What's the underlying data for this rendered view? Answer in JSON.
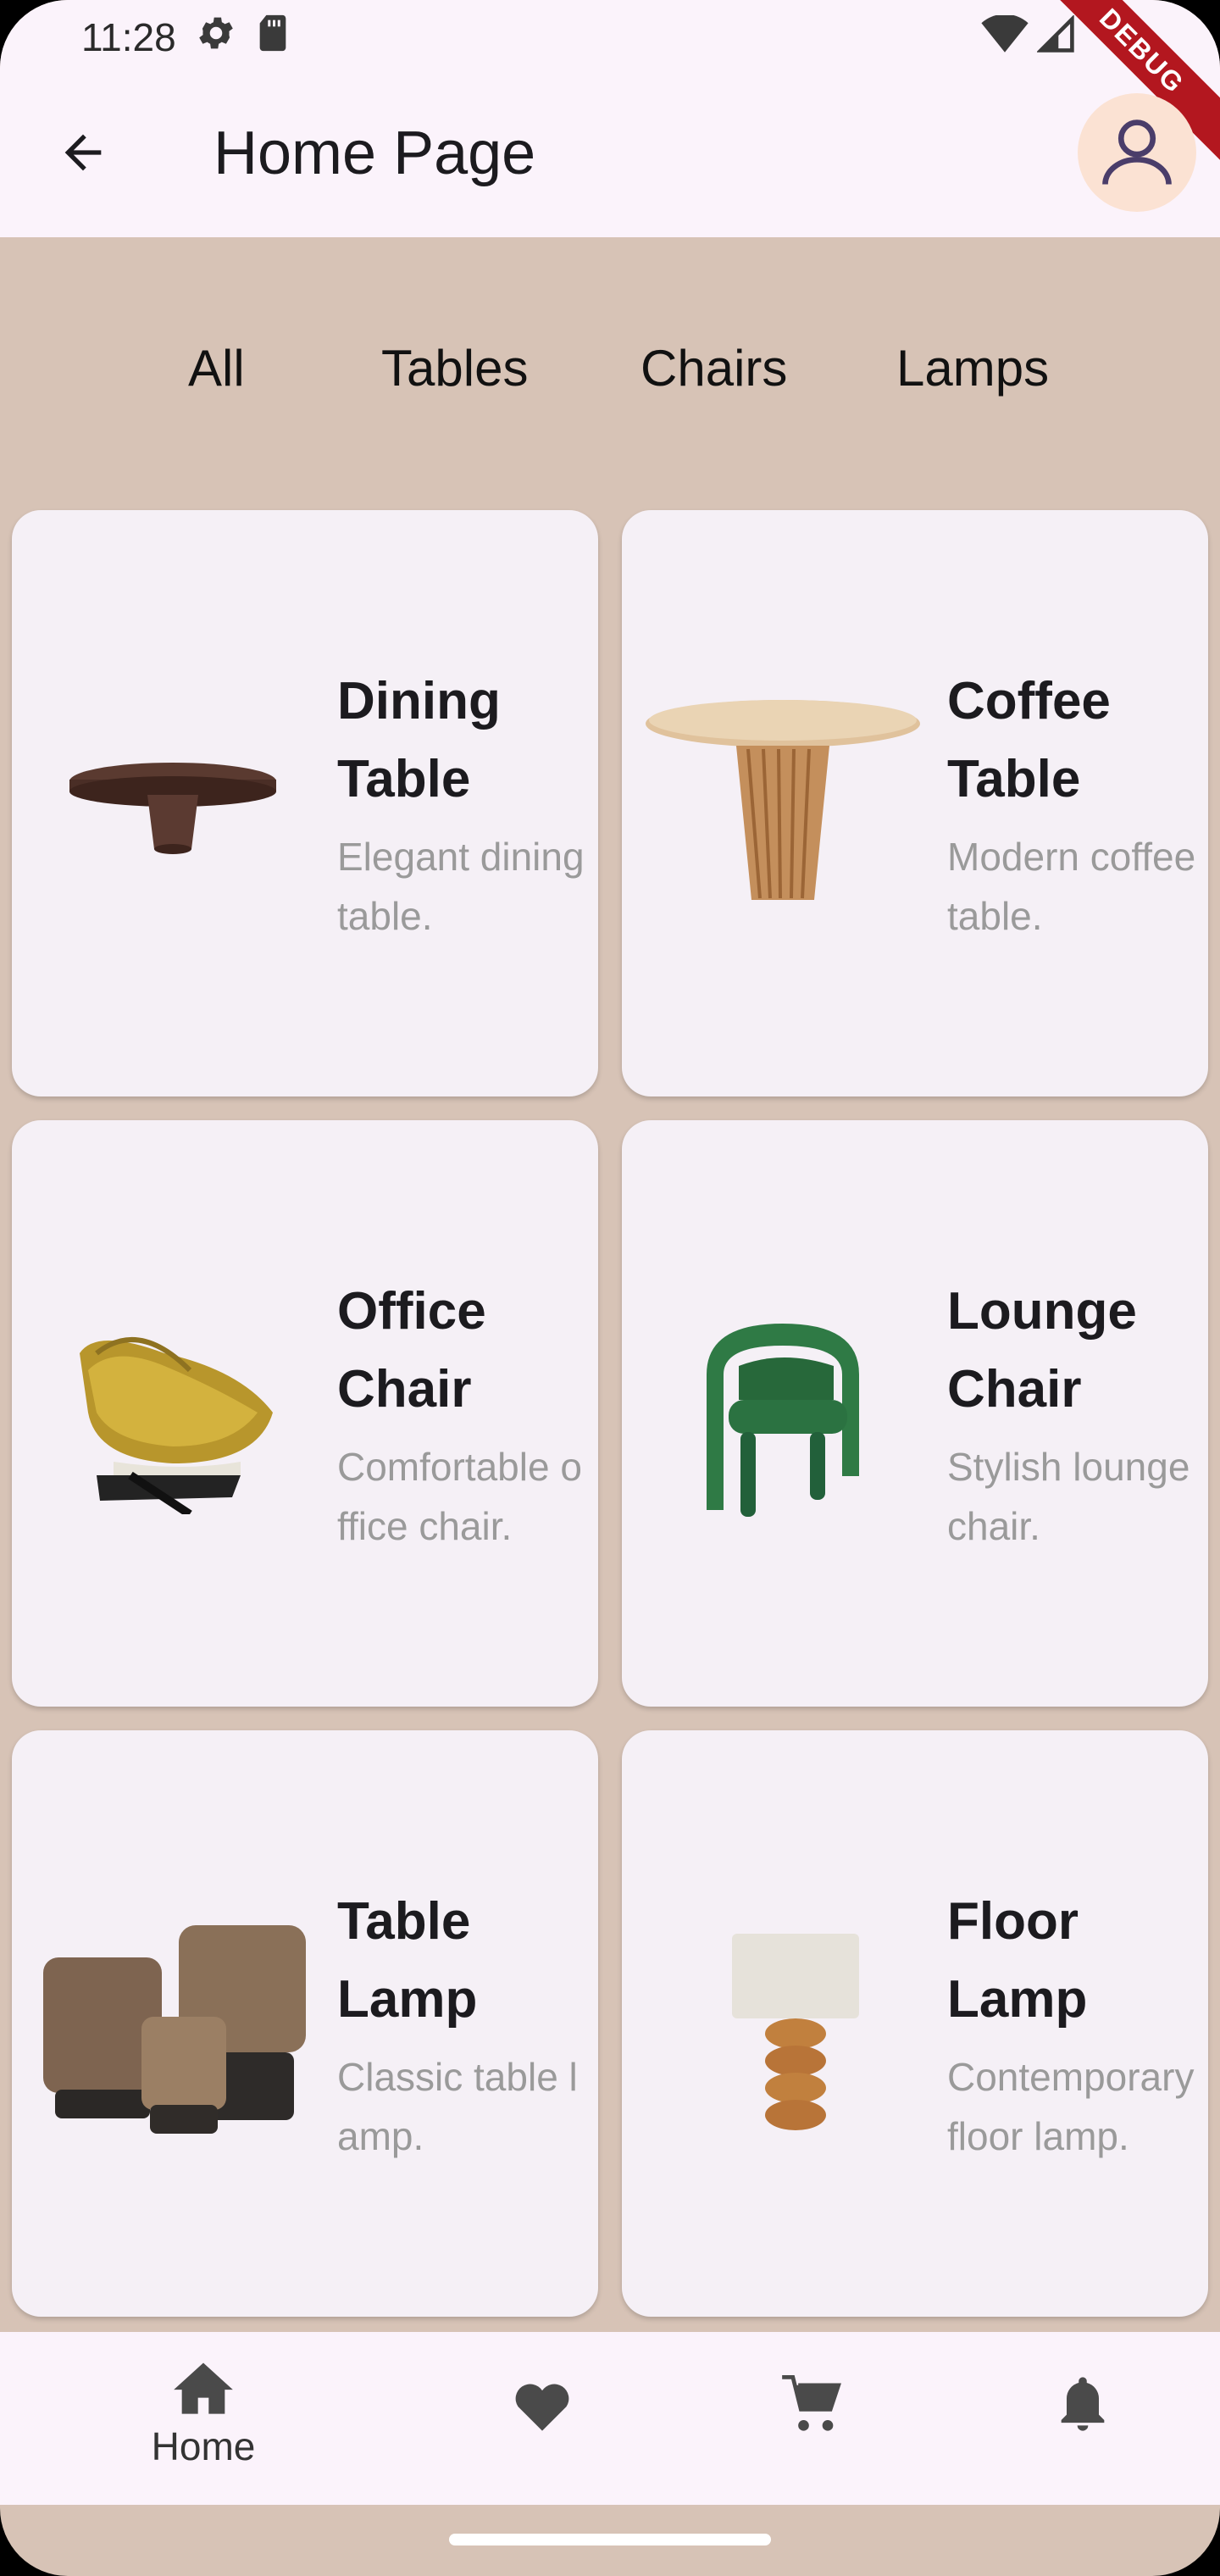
{
  "status_bar": {
    "time": "11:28"
  },
  "app_bar": {
    "title": "Home Page",
    "debug_label": "DEBUG"
  },
  "tabs": [
    "All",
    "Tables",
    "Chairs",
    "Lamps"
  ],
  "products": [
    {
      "name": "Dining Table",
      "description": "Elegant dining table."
    },
    {
      "name": "Coffee Table",
      "description": "Modern coffee table."
    },
    {
      "name": "Office Chair",
      "description": "Comfortable office chair."
    },
    {
      "name": "Lounge Chair",
      "description": "Stylish lounge chair."
    },
    {
      "name": "Table Lamp",
      "description": "Classic table lamp."
    },
    {
      "name": "Floor Lamp",
      "description": "Contemporary floor lamp."
    }
  ],
  "bottom_nav": {
    "home_label": "Home"
  },
  "colors": {
    "background": "#d7c3b6",
    "card": "#f5f0f6",
    "bar": "#fbf3fb",
    "debug": "#b3171f"
  }
}
